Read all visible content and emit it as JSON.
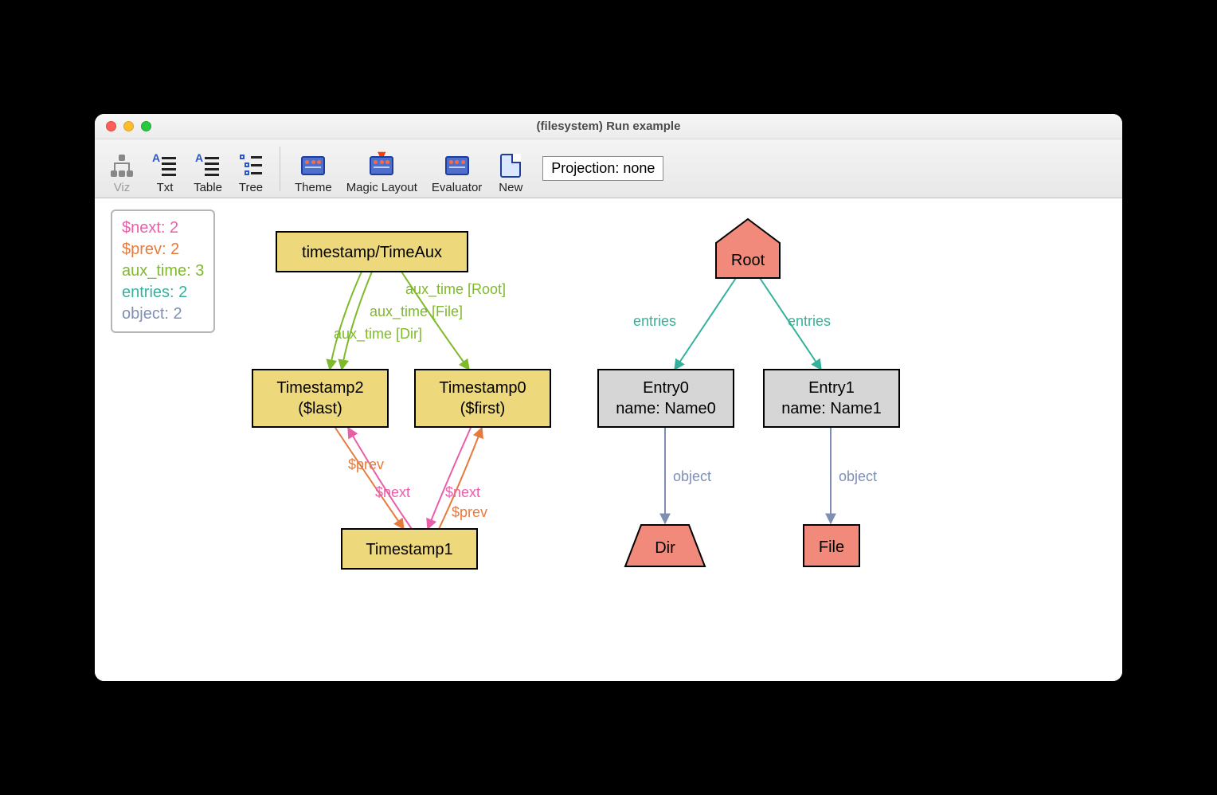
{
  "window": {
    "title": "(filesystem) Run example"
  },
  "toolbar": {
    "viz": "Viz",
    "txt": "Txt",
    "table": "Table",
    "tree": "Tree",
    "theme": "Theme",
    "magic": "Magic Layout",
    "evaluator": "Evaluator",
    "new": "New",
    "projection": "Projection: none"
  },
  "legend": {
    "next": {
      "label": "$next:",
      "value": "2"
    },
    "prev": {
      "label": "$prev:",
      "value": "2"
    },
    "aux": {
      "label": "aux_time:",
      "value": "3"
    },
    "entries": {
      "label": "entries:",
      "value": "2"
    },
    "object": {
      "label": "object:",
      "value": "2"
    }
  },
  "nodes": {
    "timeaux": "timestamp/TimeAux",
    "ts2_l1": "Timestamp2",
    "ts2_l2": "($last)",
    "ts0_l1": "Timestamp0",
    "ts0_l2": "($first)",
    "ts1": "Timestamp1",
    "root": "Root",
    "entry0_l1": "Entry0",
    "entry0_l2": "name: Name0",
    "entry1_l1": "Entry1",
    "entry1_l2": "name: Name1",
    "dir": "Dir",
    "file": "File"
  },
  "edges": {
    "aux_root": "aux_time [Root]",
    "aux_file": "aux_time [File]",
    "aux_dir": "aux_time [Dir]",
    "prev": "$prev",
    "next": "$next",
    "entries": "entries",
    "object": "object"
  },
  "colors": {
    "yellow_fill": "#edd87b",
    "yellow_stroke": "#000000",
    "grey_fill": "#d6d6d6",
    "red_fill": "#f18a7a",
    "pink": "#e85fa8",
    "orange": "#e67a3c",
    "lime": "#7fb92c",
    "teal": "#34b29b",
    "slate": "#7f8fb3"
  }
}
